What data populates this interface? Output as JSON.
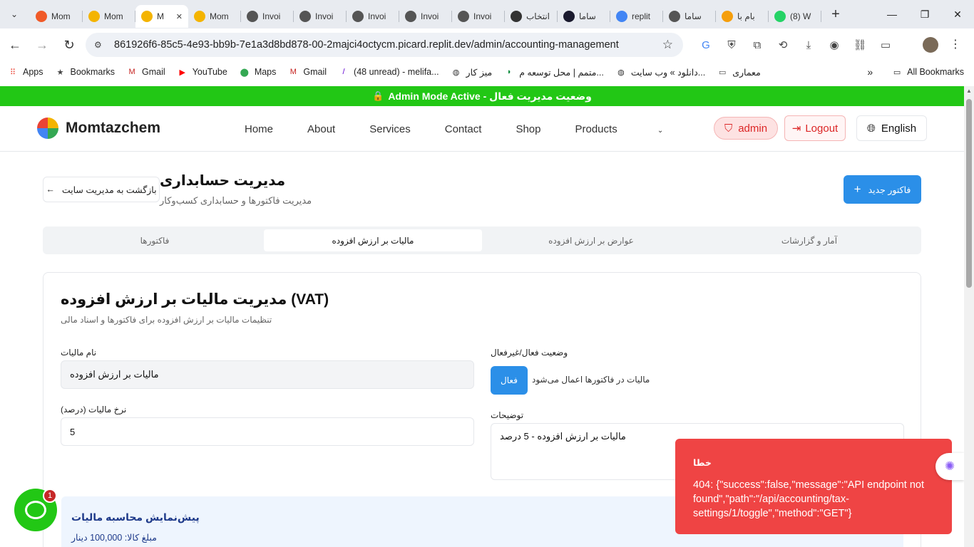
{
  "browser": {
    "tabs": [
      {
        "title": "Mom",
        "fav": "#f05a28",
        "fav_icon": "mom-icon"
      },
      {
        "title": "Mom",
        "fav": "#f4b400",
        "fav_icon": "mom-icon"
      },
      {
        "title": "M",
        "fav": "#f4b400",
        "fav_icon": "mom-icon",
        "active": true
      },
      {
        "title": "Mom",
        "fav": "#f4b400",
        "fav_icon": "mom-icon"
      },
      {
        "title": "Invoi",
        "fav": "#555",
        "fav_icon": "web-icon"
      },
      {
        "title": "Invoi",
        "fav": "#555",
        "fav_icon": "web-icon"
      },
      {
        "title": "Invoi",
        "fav": "#555",
        "fav_icon": "web-icon"
      },
      {
        "title": "Invoi",
        "fav": "#555",
        "fav_icon": "web-icon"
      },
      {
        "title": "Invoi",
        "fav": "#555",
        "fav_icon": "web-icon"
      },
      {
        "title": "انتخاب",
        "fav": "#333",
        "fav_icon": "chatgpt-icon"
      },
      {
        "title": "ساما",
        "fav": "#1a1a2e",
        "fav_icon": "react-icon"
      },
      {
        "title": "replit",
        "fav": "#4285f4",
        "fav_icon": "google-icon"
      },
      {
        "title": "ساما",
        "fav": "#555",
        "fav_icon": "web-icon"
      },
      {
        "title": "بام با",
        "fav": "#f59e0b",
        "fav_icon": "b-icon"
      },
      {
        "title": "(8) W",
        "fav": "#25d366",
        "fav_icon": "whatsapp-icon"
      }
    ],
    "url": "861926f6-85c5-4e93-bb9b-7e1a3d8bd878-00-2majci4octycm.picard.replit.dev/admin/accounting-management",
    "bookmarks": [
      {
        "label": "Apps",
        "icon": "apps-grid-icon"
      },
      {
        "label": "Bookmarks",
        "icon": "star-icon"
      },
      {
        "label": "Gmail",
        "icon": "gmail-icon"
      },
      {
        "label": "YouTube",
        "icon": "youtube-icon"
      },
      {
        "label": "Maps",
        "icon": "maps-icon"
      },
      {
        "label": "Gmail",
        "icon": "gmail-icon"
      },
      {
        "label": "(48 unread) - melifa...",
        "icon": "yahoo-icon"
      },
      {
        "label": "میز کار",
        "icon": "web-icon"
      },
      {
        "label": "متمم | محل توسعه م...",
        "icon": "motamem-icon"
      },
      {
        "label": "دانلود » وب سایت...",
        "icon": "web-icon"
      },
      {
        "label": "معماری",
        "icon": "folder-icon"
      }
    ],
    "all_bookmarks": "All Bookmarks"
  },
  "admin_banner": "Admin Mode Active - وضعیت مدیریت فعال",
  "header": {
    "logo": "Momtazchem",
    "nav": [
      "Home",
      "About",
      "Services",
      "Contact",
      "Shop",
      "Products"
    ],
    "admin_label": "admin",
    "logout_label": "Logout",
    "language_label": "English"
  },
  "page": {
    "back_label": "بازگشت به مدیریت سایت",
    "title": "مدیریت حسابداری",
    "subtitle": "مدیریت فاکتورها و حسابداری کسب‌وکار",
    "new_invoice_label": "فاکتور جدید",
    "tabs": [
      "فاکتورها",
      "مالیات بر ارزش افزوده",
      "عوارض بر ارزش افزوده",
      "آمار و گزارشات"
    ],
    "active_tab": 1
  },
  "vat_card": {
    "title": "مدیریت مالیات بر ارزش افزوده (VAT)",
    "description": "تنظیمات مالیات بر ارزش افزوده برای فاکتورها و اسناد مالی",
    "name_label": "نام مالیات",
    "name_value": "مالیات بر ارزش افزوده",
    "status_label": "وضعیت فعال/غیرفعال",
    "toggle_label": "فعال",
    "toggle_help": "مالیات در فاکتورها اعمال می‌شود",
    "rate_label": "نرخ مالیات (درصد)",
    "rate_value": "5",
    "desc_label": "توضیحات",
    "desc_value": "مالیات بر ارزش افزوده - 5 درصد"
  },
  "preview": {
    "title": "پیش‌نمایش محاسبه مالیات",
    "line": "مبلغ کالا: 100,000 دینار"
  },
  "toast": {
    "title": "خطا",
    "message": "404: {\"success\":false,\"message\":\"API endpoint not found\",\"path\":\"/api/accounting/tax-settings/1/toggle\",\"method\":\"GET\"}"
  },
  "chat_badge": "1",
  "colors": {
    "admin_green": "#22c715",
    "primary_blue": "#2b8fe8",
    "error_red": "#ef4444"
  }
}
